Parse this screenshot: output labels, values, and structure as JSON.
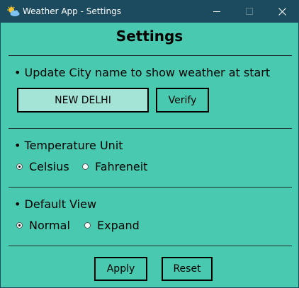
{
  "window": {
    "title": "Weather App - Settings",
    "controls": {
      "minimize_icon": "minimize-icon",
      "maximize_icon": "maximize-icon",
      "close_icon": "close-icon"
    },
    "colors": {
      "titlebar": "#1c4a5e",
      "background": "#48C9B0",
      "input_bg": "#A3E4D7"
    }
  },
  "heading": "Settings",
  "city_section": {
    "label": "• Update City name to show weather at start",
    "input_value": "NEW DELHI",
    "verify_label": "Verify"
  },
  "unit_section": {
    "label": "• Temperature Unit",
    "options": [
      {
        "label": "Celsius",
        "selected": true
      },
      {
        "label": "Fahreneit",
        "selected": false
      }
    ]
  },
  "view_section": {
    "label": "• Default View",
    "options": [
      {
        "label": "Normal",
        "selected": true
      },
      {
        "label": "Expand",
        "selected": false
      }
    ]
  },
  "footer": {
    "apply_label": "Apply",
    "reset_label": "Reset"
  }
}
